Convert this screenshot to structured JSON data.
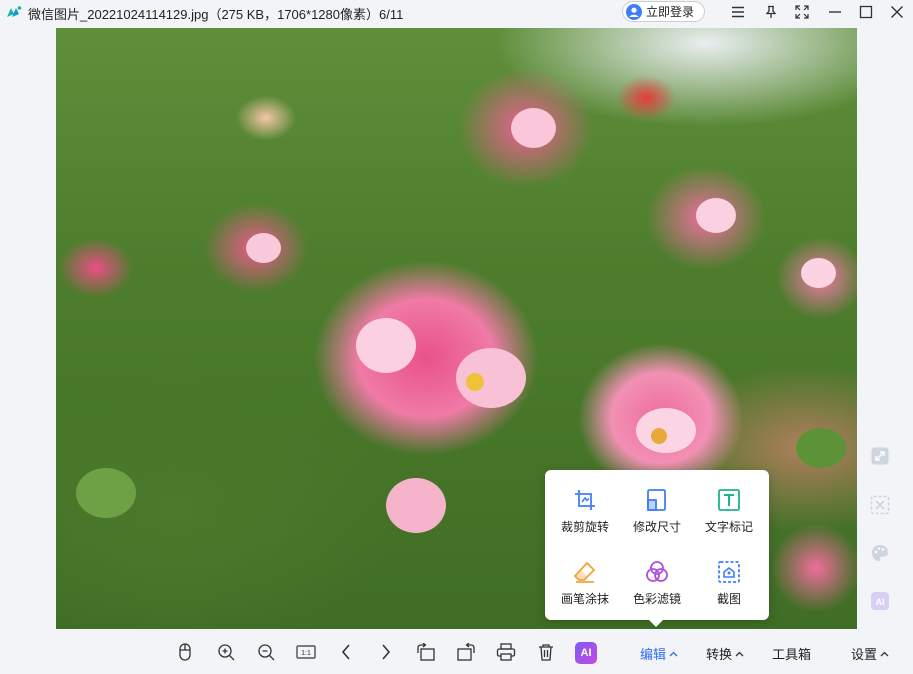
{
  "window": {
    "title": "微信图片_20221024114129.jpg（275 KB，1706*1280像素）6/11",
    "login_label": "立即登录",
    "icons": [
      "menu-icon",
      "pin-icon",
      "fullscreen-icon",
      "minimize-icon",
      "maximize-icon",
      "close-icon"
    ]
  },
  "photo": {
    "description_icon": "photo-roses"
  },
  "side_tools": [
    "fit-screen-icon",
    "scan-icon",
    "palette-icon",
    "ai-side-icon"
  ],
  "edit_menu": {
    "items": [
      {
        "label": "裁剪旋转",
        "icon": "crop-rotate-icon"
      },
      {
        "label": "修改尺寸",
        "icon": "resize-icon"
      },
      {
        "label": "文字标记",
        "icon": "text-mark-icon"
      },
      {
        "label": "画笔涂抹",
        "icon": "eraser-icon"
      },
      {
        "label": "色彩滤镜",
        "icon": "color-filter-icon"
      },
      {
        "label": "截图",
        "icon": "screenshot-icon"
      }
    ],
    "accent": "#3f7ef7"
  },
  "toolbar": {
    "ai_label": "AI",
    "menus": [
      {
        "label": "编辑",
        "active": true
      },
      {
        "label": "转换",
        "active": false
      },
      {
        "label": "工具箱",
        "active": false
      },
      {
        "label": "设置",
        "active": false
      }
    ],
    "active_color": "#2f6bf2"
  }
}
